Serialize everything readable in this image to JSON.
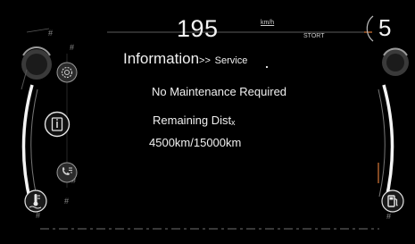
{
  "speed": {
    "value": "195",
    "unit": "km/h",
    "mode": "STORT"
  },
  "gear": "5",
  "menu": {
    "title": "Information",
    "separator": ">>",
    "subtitle": "Service"
  },
  "service": {
    "status": "No Maintenance Required",
    "remaining_label": "Remaining Distₓ",
    "remaining_value": "4500km/15000km"
  },
  "icons": {
    "left_menu": [
      "gear-icon",
      "info-icon",
      "phone-list-icon"
    ],
    "left_bottom": "coolant-temperature-icon",
    "right_bottom": "fuel-icon"
  },
  "colors": {
    "accent": "#d9793a",
    "background": "#000000",
    "text": "#f0f0f0"
  }
}
